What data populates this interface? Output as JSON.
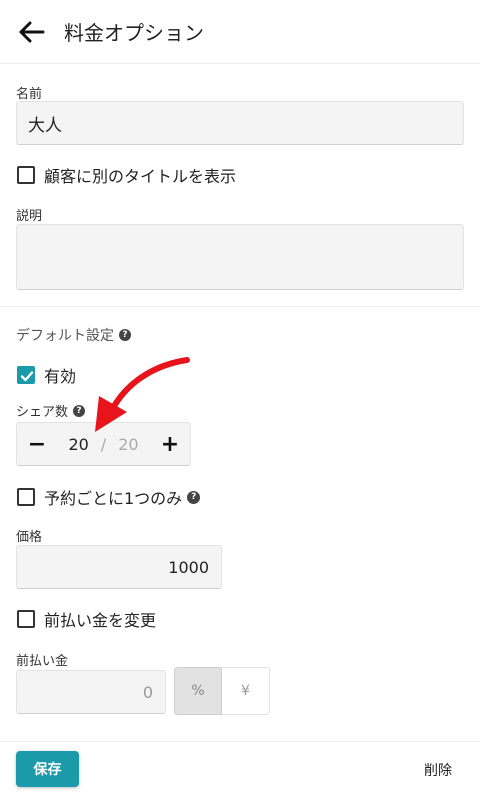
{
  "header": {
    "title": "料金オプション",
    "back_icon": "arrow-left-icon"
  },
  "name": {
    "label": "名前",
    "value": "大人"
  },
  "alt_title": {
    "label": "顧客に別のタイトルを表示",
    "checked": false
  },
  "description": {
    "label": "説明",
    "value": ""
  },
  "defaults": {
    "heading": "デフォルト設定"
  },
  "enabled": {
    "label": "有効",
    "checked": true
  },
  "shares": {
    "label": "シェア数",
    "value": "20",
    "separator": "/",
    "max": "20",
    "minus": "−",
    "plus": "+"
  },
  "once_per_booking": {
    "label": "予約ごとに1つのみ",
    "checked": false
  },
  "price": {
    "label": "価格",
    "value": "1000"
  },
  "change_deposit": {
    "label": "前払い金を変更",
    "checked": false
  },
  "deposit": {
    "label": "前払い金",
    "value": "0",
    "unit_percent": "%",
    "unit_yen": "¥",
    "selected_unit": "%"
  },
  "footer": {
    "save_label": "保存",
    "delete_label": "削除"
  },
  "colors": {
    "accent": "#1b9aaa",
    "annotation_arrow": "#e8141b"
  }
}
